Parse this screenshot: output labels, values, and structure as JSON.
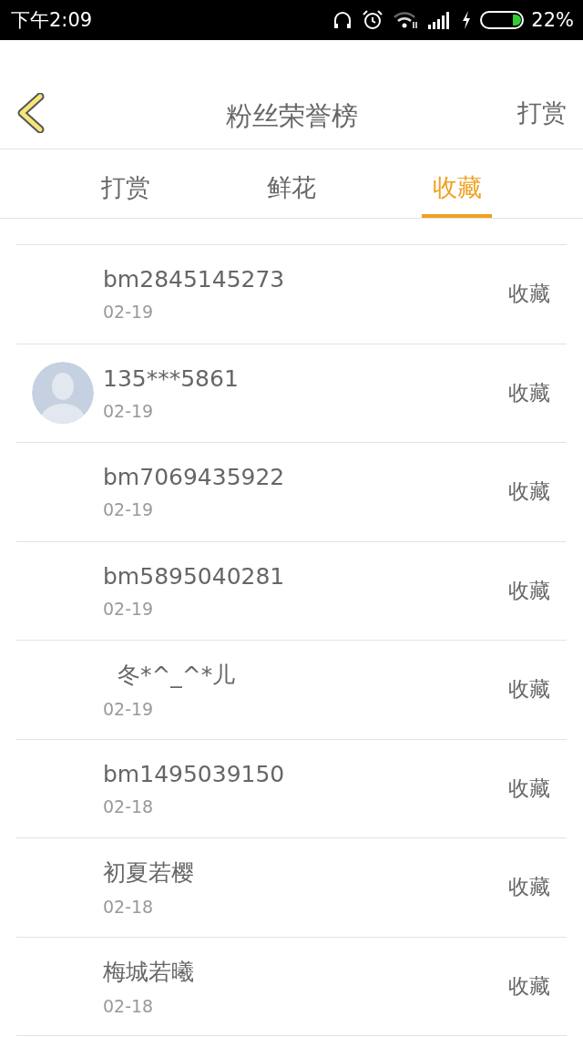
{
  "status_bar": {
    "time": "下午2:09",
    "battery": "22%"
  },
  "header": {
    "title": "粉丝荣誉榜",
    "action": "打赏"
  },
  "tabs": [
    {
      "label": "打赏",
      "selected": false
    },
    {
      "label": "鲜花",
      "selected": false
    },
    {
      "label": "收藏",
      "selected": true
    }
  ],
  "rows": [
    {
      "name": "bm2845145273",
      "date": "02-19",
      "action": "收藏",
      "avatar": false
    },
    {
      "name": "135***5861",
      "date": "02-19",
      "action": "收藏",
      "avatar": true
    },
    {
      "name": "bm7069435922",
      "date": "02-19",
      "action": "收藏",
      "avatar": false
    },
    {
      "name": "bm5895040281",
      "date": "02-19",
      "action": "收藏",
      "avatar": false
    },
    {
      "name": "  冬*^_^*儿",
      "date": "02-19",
      "action": "收藏",
      "avatar": false
    },
    {
      "name": "bm1495039150",
      "date": "02-18",
      "action": "收藏",
      "avatar": false
    },
    {
      "name": "初夏若樱",
      "date": "02-18",
      "action": "收藏",
      "avatar": false
    },
    {
      "name": "梅城若曦",
      "date": "02-18",
      "action": "收藏",
      "avatar": false
    }
  ]
}
